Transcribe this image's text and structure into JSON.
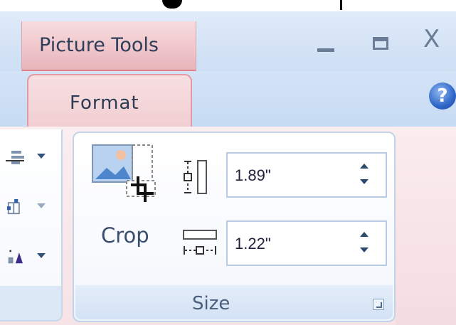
{
  "window": {
    "context_tab_label": "Picture Tools",
    "minimize_icon": "minimize-icon",
    "maximize_icon": "maximize-icon",
    "close_label": "X"
  },
  "ribbon": {
    "active_tab_label": "Format",
    "help_label": "?",
    "accent_color": "#e07f8b"
  },
  "size_group": {
    "label": "Size",
    "crop_label": "Crop",
    "height_value": "1.89\"",
    "width_value": "1.22\""
  }
}
